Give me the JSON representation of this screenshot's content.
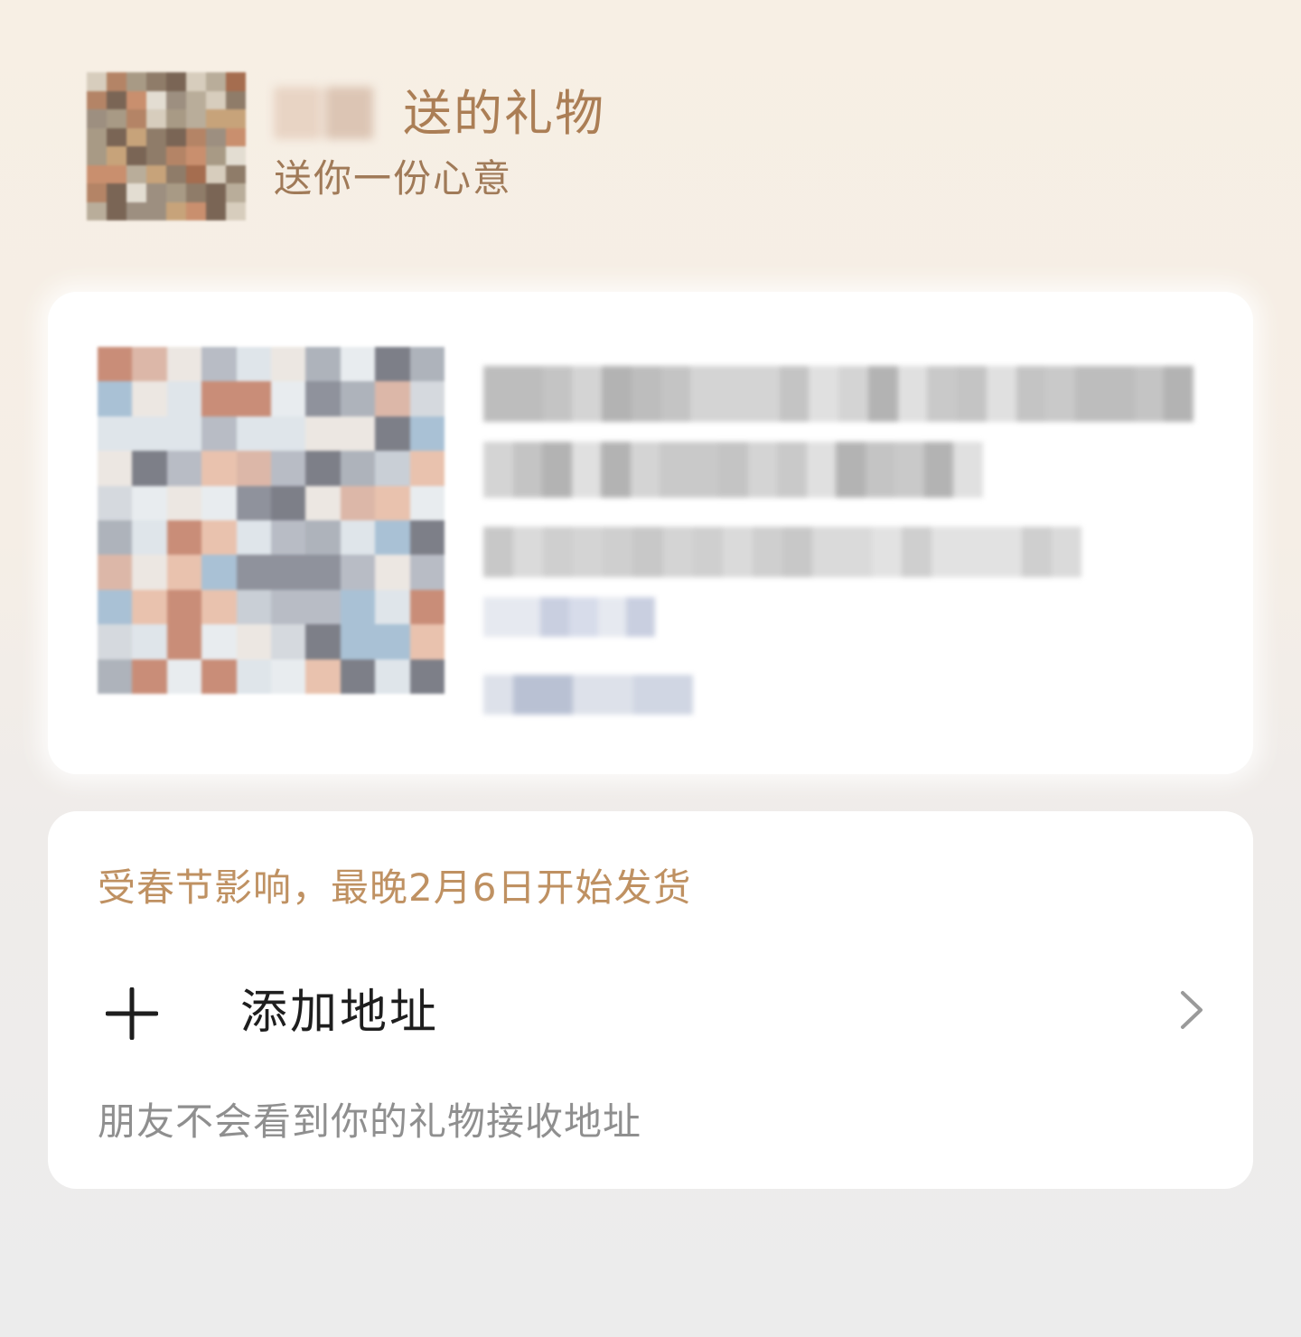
{
  "header": {
    "gift_title": "送的礼物",
    "subtitle": "送你一份心意"
  },
  "address_card": {
    "shipping_notice": "受春节影响，最晚2月6日开始发货",
    "add_address_label": "添加地址",
    "privacy_note": "朋友不会看到你的礼物接收地址"
  },
  "colors": {
    "accent": "#bf9162",
    "title_brown": "#ab7e55",
    "text_primary": "#1e1e1e",
    "text_secondary": "#8f8f8f",
    "card_bg": "#ffffff"
  },
  "icons": {
    "add": "plus-icon",
    "navigate": "chevron-right-icon"
  }
}
